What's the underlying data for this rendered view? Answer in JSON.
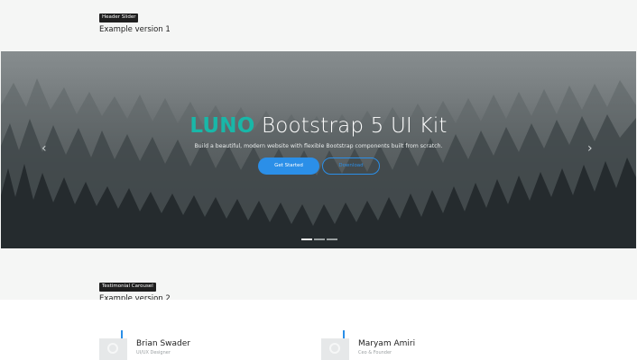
{
  "section1": {
    "tag": "Header Slider",
    "subtitle": "Example version 1"
  },
  "hero": {
    "brand": "LUNO",
    "title_rest": "Bootstrap 5 UI Kit",
    "description": "Build a beautiful, modern website with flexible Bootstrap components built from scratch.",
    "primary_button": "Get Started",
    "secondary_button": "Download",
    "prev_icon": "chevron-left-icon",
    "next_icon": "chevron-right-icon",
    "prev_glyph": "‹",
    "next_glyph": "›",
    "indicators_count": 3,
    "active_indicator": 1
  },
  "section2": {
    "tag": "Testimonial Carousel",
    "subtitle": "Example version 2"
  },
  "testimonials": [
    {
      "name": "Brian Swader",
      "role": "UI/UX Designer"
    },
    {
      "name": "Maryam Amiri",
      "role": "Ceo & Founder"
    }
  ],
  "colors": {
    "accent": "#2b8fe8",
    "brand": "#19b7a8",
    "tag_bg": "#1f1f1f"
  }
}
